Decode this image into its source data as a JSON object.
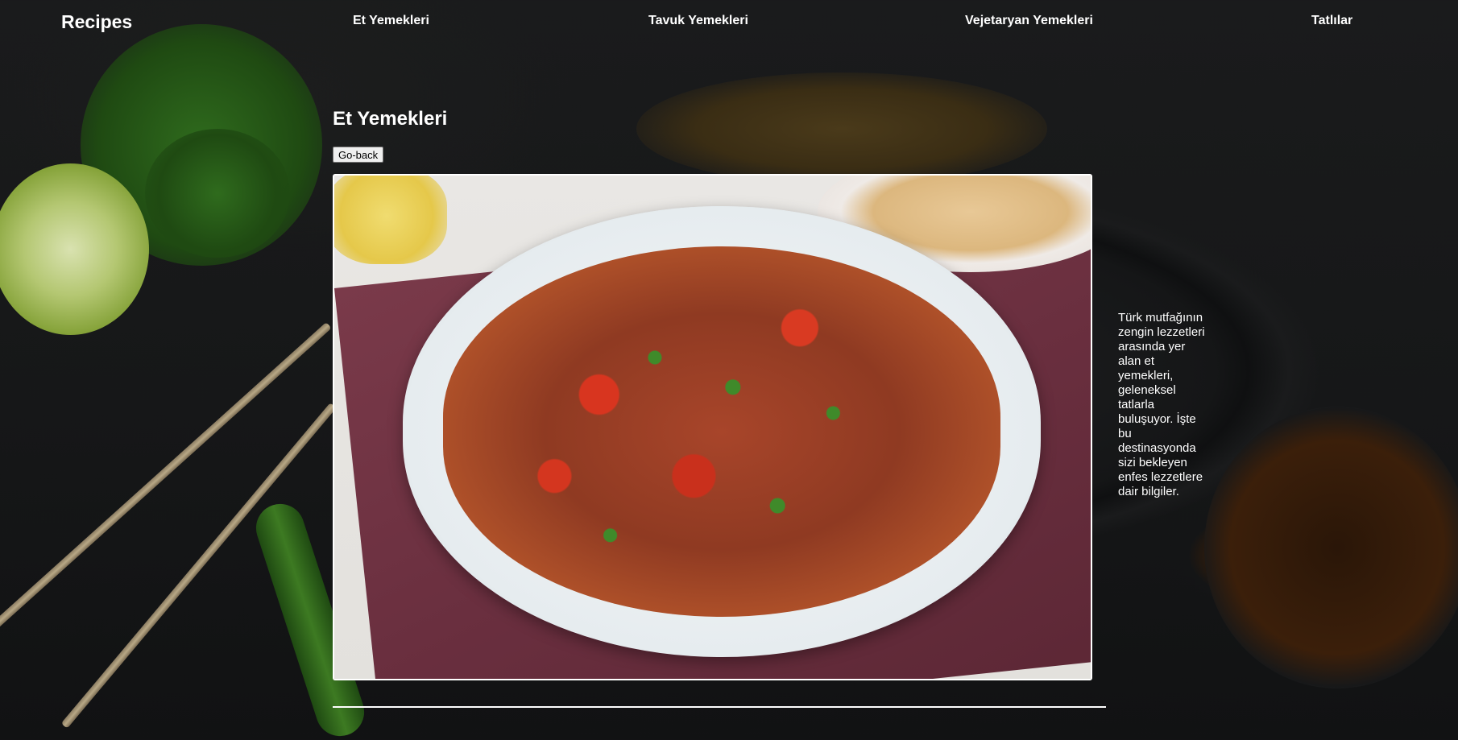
{
  "nav": {
    "brand": "Recipes",
    "links": [
      {
        "label": "Et Yemekleri"
      },
      {
        "label": "Tavuk Yemekleri"
      },
      {
        "label": "Vejetaryan Yemekleri"
      },
      {
        "label": "Tatlılar"
      }
    ]
  },
  "main": {
    "title": "Et Yemekleri",
    "back_button": "Go-back",
    "description": "Türk mutfağının zengin lezzetleri arasında yer alan et yemekleri, geleneksel tatlarla buluşuyor. İşte bu destinasyonda sizi bekleyen enfes lezzetlere dair bilgiler."
  },
  "colors": {
    "text": "#ffffff",
    "background": "#161718"
  }
}
